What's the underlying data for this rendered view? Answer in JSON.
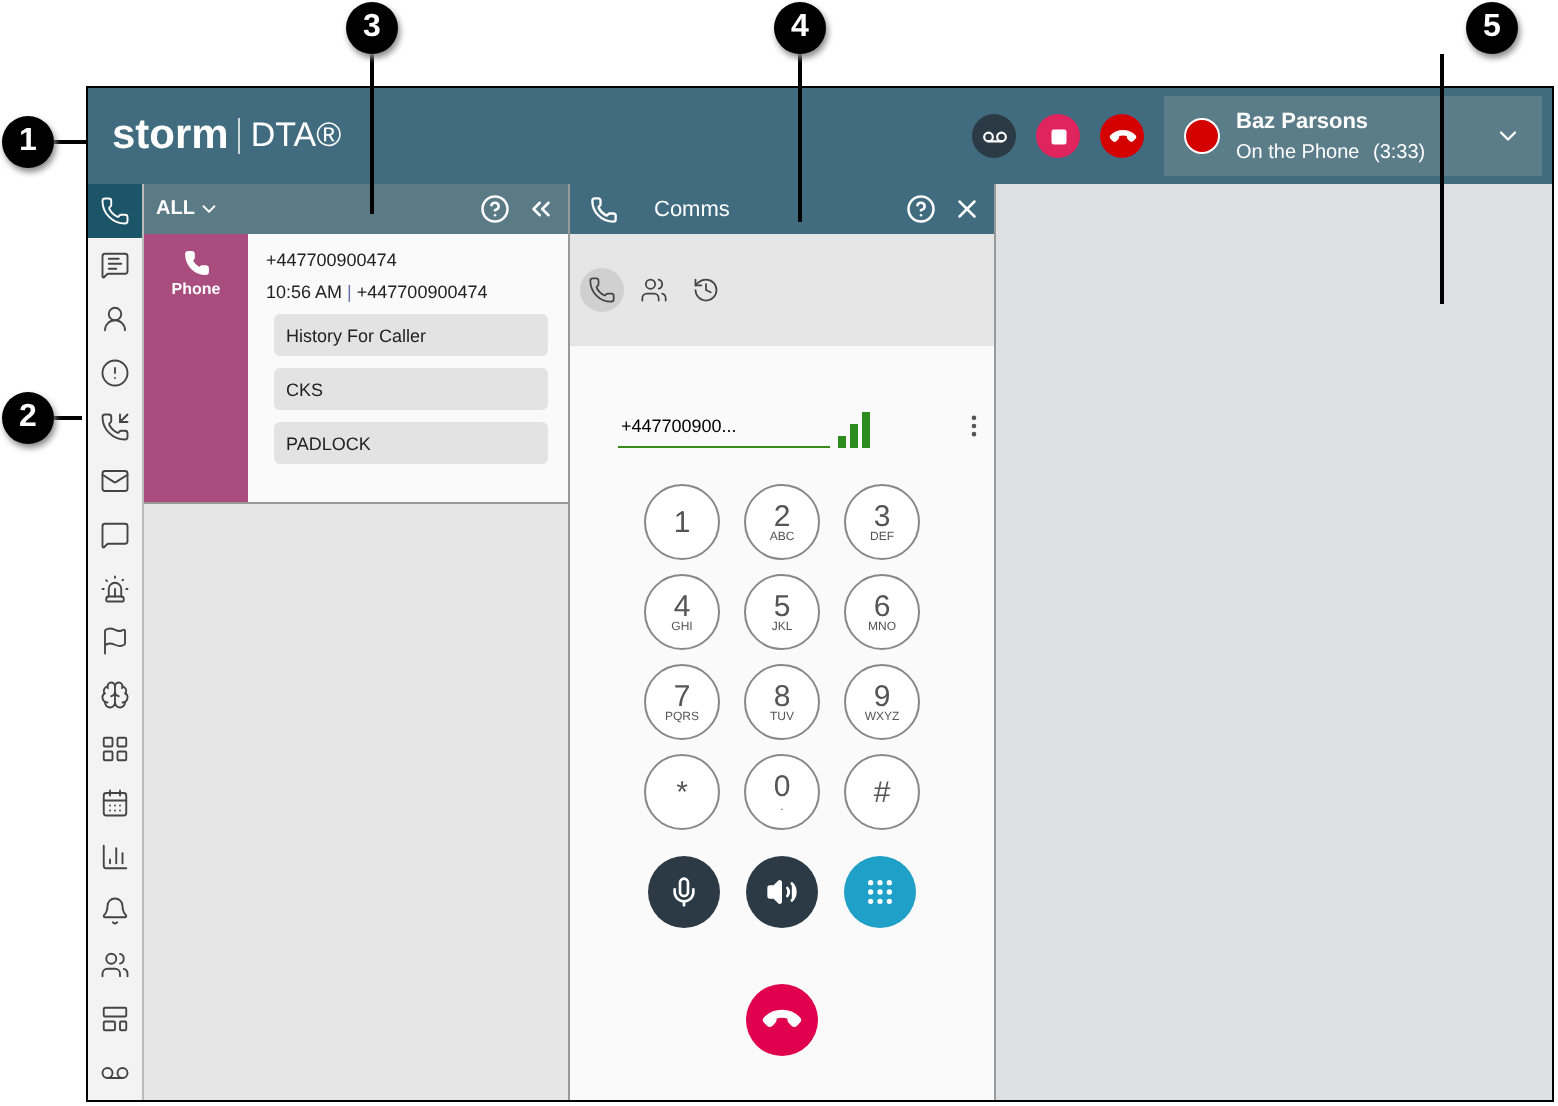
{
  "callouts": [
    {
      "label": "1"
    },
    {
      "label": "2"
    },
    {
      "label": "3"
    },
    {
      "label": "4"
    },
    {
      "label": "5"
    }
  ],
  "header": {
    "logo": "storm",
    "product": "DTA®",
    "user": {
      "name": "Baz Parsons",
      "status": "On the Phone",
      "timer": "(3:33)"
    }
  },
  "rail": [
    {
      "selected": true
    },
    {
      "selected": false
    },
    {
      "selected": false
    },
    {
      "selected": false
    },
    {
      "selected": false
    },
    {
      "selected": false
    },
    {
      "selected": false
    },
    {
      "selected": false
    },
    {
      "selected": false
    },
    {
      "selected": false
    },
    {
      "selected": false
    },
    {
      "selected": false
    },
    {
      "selected": false
    },
    {
      "selected": false
    },
    {
      "selected": false
    },
    {
      "selected": false
    },
    {
      "selected": false
    }
  ],
  "queue_panel": {
    "filter": "ALL",
    "item": {
      "channel": "Phone",
      "number": "+447700900474",
      "time": "10:56 AM",
      "separator": "|",
      "caller": "+447700900474",
      "actions": [
        "History For Caller",
        "CKS",
        "PADLOCK"
      ]
    }
  },
  "comms_panel": {
    "title": "Comms",
    "tabs": [
      {
        "selected": true
      },
      {
        "selected": false
      },
      {
        "selected": false
      }
    ],
    "number": "+447700900...",
    "keys": [
      {
        "digit": "1"
      },
      {
        "digit": "2",
        "letters": "ABC"
      },
      {
        "digit": "3",
        "letters": "DEF"
      },
      {
        "digit": "4",
        "letters": "GHI"
      },
      {
        "digit": "5",
        "letters": "JKL"
      },
      {
        "digit": "6",
        "letters": "MNO"
      },
      {
        "digit": "7",
        "letters": "PQRS"
      },
      {
        "digit": "8",
        "letters": "TUV"
      },
      {
        "digit": "9",
        "letters": "WXYZ"
      },
      {
        "digit": "*"
      },
      {
        "digit": "0",
        "letters": "."
      },
      {
        "digit": "#"
      }
    ],
    "controls": [
      {
        "selected": false
      },
      {
        "selected": false
      },
      {
        "selected": true
      }
    ]
  }
}
